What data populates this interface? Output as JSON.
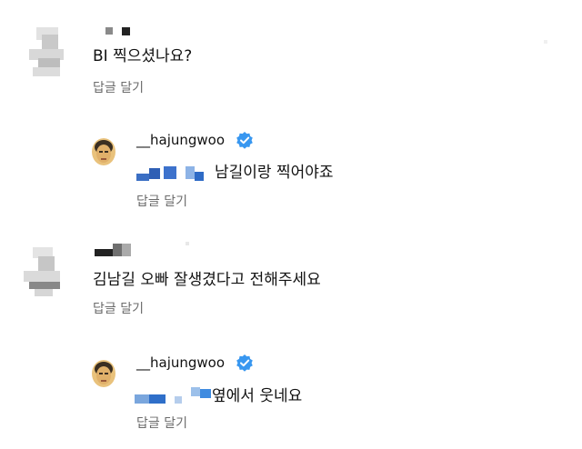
{
  "colors": {
    "verified": "#3897f0",
    "secondary_text": "#6b6b6b",
    "primary_text": "#111111"
  },
  "comments": [
    {
      "text": "BI 찍으셨나요?",
      "reply_label": "답글 달기",
      "reply": {
        "username": "__hajungwoo",
        "verified_icon": "verified-badge-icon",
        "text": "남길이랑 찍어야죠",
        "reply_label": "답글 달기"
      }
    },
    {
      "text": "김남길 오빠 잘생겼다고 전해주세요",
      "reply_label": "답글 달기",
      "reply": {
        "username": "__hajungwoo",
        "verified_icon": "verified-badge-icon",
        "text": "옆에서 웃네요",
        "reply_label": "답글 달기"
      }
    }
  ]
}
